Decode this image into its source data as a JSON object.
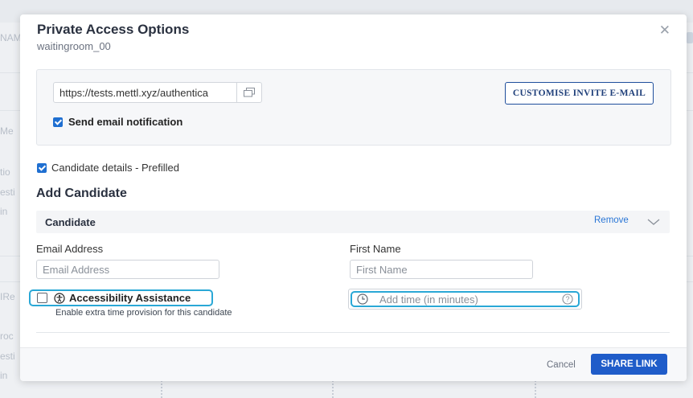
{
  "background": {
    "left_fragments": [
      "NAM",
      "Me",
      "tio",
      "esti",
      "in",
      "IRe",
      "roc",
      "esti",
      "in"
    ]
  },
  "modal": {
    "title": "Private Access Options",
    "subtitle": "waitingroom_00",
    "close_icon": "close-icon"
  },
  "invite": {
    "url_value": "https://tests.mettl.xyz/authentica",
    "copy_icon": "copy-icon",
    "customise_label": "CUSTOMISE INVITE E-MAIL",
    "send_email_label": "Send email notification",
    "send_email_checked": true
  },
  "prefill": {
    "label": "Candidate details - Prefilled",
    "checked": true
  },
  "add_candidate": {
    "title": "Add Candidate",
    "candidate_header": "Candidate",
    "remove_label": "Remove",
    "email_label": "Email Address",
    "email_placeholder": "Email Address",
    "first_name_label": "First Name",
    "first_name_placeholder": "First Name",
    "accessibility_label": "Accessibility Assistance",
    "accessibility_checked": false,
    "accessibility_hint": "Enable extra time provision for this candidate",
    "time_placeholder": "Add time (in minutes)"
  },
  "footer": {
    "cancel_label": "Cancel",
    "share_label": "SHARE LINK"
  },
  "colors": {
    "accent": "#1f5cc9",
    "highlight": "#2aa8d6",
    "link": "#2a76d6"
  }
}
